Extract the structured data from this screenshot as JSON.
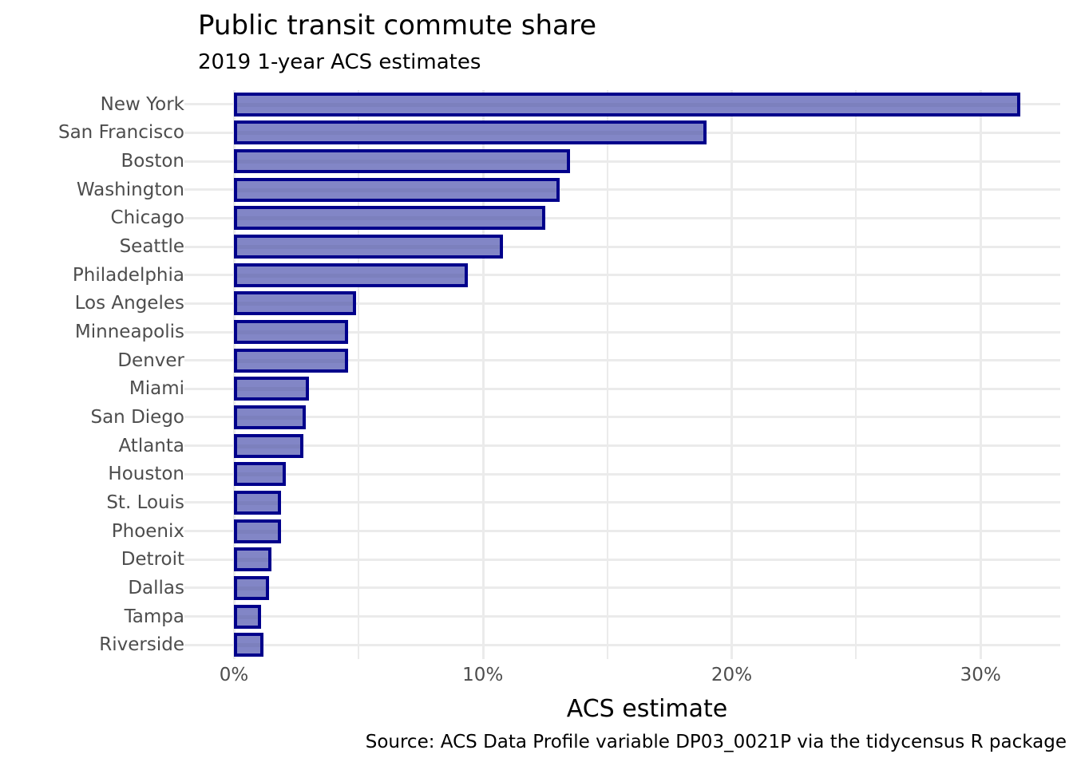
{
  "chart_data": {
    "type": "bar",
    "orientation": "horizontal",
    "title": "Public transit commute share",
    "subtitle": "2019 1-year ACS estimates",
    "caption": "Source: ACS Data Profile variable DP03_0021P via the tidycensus R package",
    "xlabel": "ACS estimate",
    "ylabel": "",
    "categories": [
      "New York",
      "San Francisco",
      "Boston",
      "Washington",
      "Chicago",
      "Seattle",
      "Philadelphia",
      "Los Angeles",
      "Minneapolis",
      "Denver",
      "Miami",
      "San Diego",
      "Atlanta",
      "Houston",
      "St. Louis",
      "Phoenix",
      "Detroit",
      "Dallas",
      "Tampa",
      "Riverside"
    ],
    "values": [
      31.6,
      19.0,
      13.5,
      13.1,
      12.5,
      10.8,
      9.4,
      4.9,
      4.6,
      4.6,
      3.0,
      2.9,
      2.8,
      2.1,
      1.9,
      1.9,
      1.5,
      1.4,
      1.1,
      1.2
    ],
    "value_unit": "percent",
    "xlim": [
      0,
      33.2
    ],
    "xticks": [
      0,
      10,
      20,
      30
    ],
    "xtick_labels": [
      "0%",
      "10%",
      "20%",
      "30%"
    ],
    "x_minor_ticks": [
      5,
      15,
      25
    ],
    "grid": true,
    "legend": "none",
    "bar_fill_color": "#8286c6",
    "bar_border_color": "#00008b",
    "grid_color": "#ebebeb",
    "panel_background": "#ffffff",
    "axis_text_color": "#4d4d4d"
  }
}
